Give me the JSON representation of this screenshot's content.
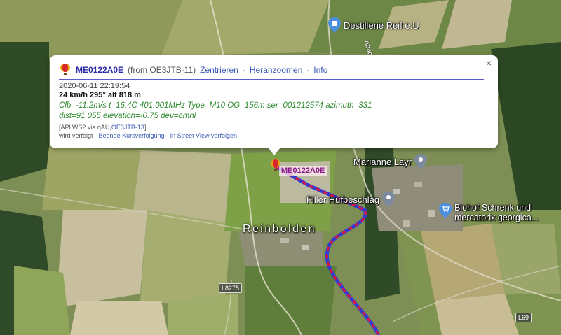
{
  "map": {
    "town_label": "Reinbolden",
    "roads": [
      "L8275",
      "L69"
    ],
    "street_fragment": "nbach",
    "pois": [
      {
        "name": "Destillerie Reif e.U",
        "icon": "shopping-bag-icon"
      },
      {
        "name": "Marianne Layr",
        "icon": "location-pin-icon"
      },
      {
        "name": "Filler Hufbeschlag",
        "icon": "location-pin-icon"
      },
      {
        "name": "Biohof Schrenk und mercatorix georgica...",
        "line1": "Biohof Schrenk und",
        "line2": "mercatorix georgica...",
        "icon": "shopping-cart-icon"
      }
    ],
    "marker_label": "ME0122A0E",
    "track_colors": {
      "primary": "#2f3bd6",
      "secondary": "#e0163a"
    }
  },
  "popup": {
    "callsign": "ME0122A0E",
    "from": "(from OE3JTB-11)",
    "links": [
      "Zentrieren",
      "Heranzoomen",
      "Info"
    ],
    "timestamp": "2020-06-11 22:19:54",
    "speed_line": "24 km/h 295° alt 818 m",
    "comment_line1": "Clb=-11.2m/s t=16.4C 401.001MHz Type=M10 OG=156m ser=001212574 azimuth=331",
    "comment_line2": "dist=91.055 elevation=-0.75 dev=omni",
    "path_prefix": "[APLWS2 via qAU,",
    "path_link": "OE3JTB-13",
    "path_suffix": "]",
    "tracking_status": "wird verfolgt",
    "tracking_links": [
      "Beende Kursverfolgung",
      "In Street View verfolgen"
    ],
    "close_symbol": "×"
  }
}
